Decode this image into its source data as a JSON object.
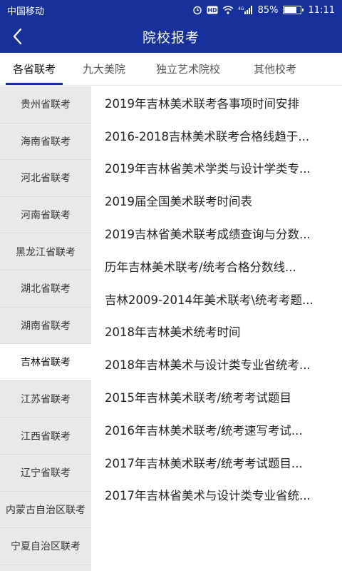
{
  "status_bar": {
    "carrier": "中国移动",
    "network": "4G",
    "battery": "85%",
    "battery_level": 0.85,
    "time": "11:11",
    "icons": [
      "alarm-icon",
      "hd-icon",
      "wifi-icon",
      "signal-icon",
      "battery-icon"
    ]
  },
  "header": {
    "title": "院校报考",
    "back_icon": "chevron-left-icon",
    "background": "#16309c"
  },
  "tabs": [
    {
      "label": "各省联考",
      "active": true
    },
    {
      "label": "九大美院",
      "active": false
    },
    {
      "label": "独立艺术院校",
      "active": false
    },
    {
      "label": "其他校考",
      "active": false
    }
  ],
  "sidebar": {
    "items": [
      {
        "label": "贵州省联考",
        "active": false
      },
      {
        "label": "海南省联考",
        "active": false
      },
      {
        "label": "河北省联考",
        "active": false
      },
      {
        "label": "河南省联考",
        "active": false
      },
      {
        "label": "黑龙江省联考",
        "active": false
      },
      {
        "label": "湖北省联考",
        "active": false
      },
      {
        "label": "湖南省联考",
        "active": false
      },
      {
        "label": "吉林省联考",
        "active": true
      },
      {
        "label": "江苏省联考",
        "active": false
      },
      {
        "label": "江西省联考",
        "active": false
      },
      {
        "label": "辽宁省联考",
        "active": false
      },
      {
        "label": "内蒙古自治区联考",
        "active": false
      },
      {
        "label": "宁夏自治区联考",
        "active": false
      }
    ]
  },
  "articles": [
    "2019年吉林美术联考各事项时间安排",
    "2016-2018吉林美术联考合格线趋于...",
    "2019年吉林省美术学类与设计学类专...",
    "2019届全国美术联考时间表",
    "2019吉林省美术联考成绩查询与分数...",
    "历年吉林美术联考/统考合格分数线...",
    "吉林2009-2014年美术联考\\统考考题...",
    "2018年吉林美术统考时间",
    "2018年吉林美术与设计类专业省统考...",
    "2015年吉林美术联考/统考考试题目",
    "2016年吉林美术联考/统考速写考试...",
    "2017年吉林美术联考/统考考试题目...",
    "2017年吉林省美术与设计类专业省统..."
  ]
}
